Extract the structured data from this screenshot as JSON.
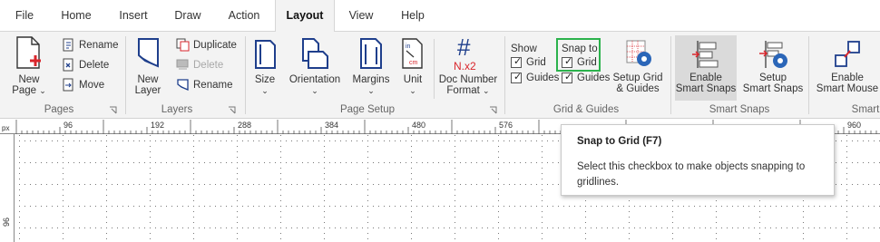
{
  "tabs": [
    {
      "label": "File",
      "active": false
    },
    {
      "label": "Home",
      "active": false
    },
    {
      "label": "Insert",
      "active": false
    },
    {
      "label": "Draw",
      "active": false
    },
    {
      "label": "Action",
      "active": false
    },
    {
      "label": "Layout",
      "active": true
    },
    {
      "label": "View",
      "active": false
    },
    {
      "label": "Help",
      "active": false
    }
  ],
  "pages_group": {
    "label": "Pages",
    "new_page": {
      "line1": "New",
      "line2": "Page",
      "icon": "new-page-icon"
    },
    "rename": "Rename",
    "delete": "Delete",
    "move": "Move"
  },
  "layers_group": {
    "label": "Layers",
    "new_layer": {
      "line1": "New",
      "line2": "Layer",
      "icon": "new-layer-icon"
    },
    "duplicate": "Duplicate",
    "delete": "Delete",
    "rename": "Rename"
  },
  "page_setup_group": {
    "label": "Page Setup",
    "size": "Size",
    "orientation": "Orientation",
    "margins": "Margins",
    "unit": "Unit",
    "doc_number": {
      "line1": "Doc Number",
      "line2": "Format",
      "icon_text": "N.x2"
    }
  },
  "grid_group": {
    "label": "Grid & Guides",
    "show_label": "Show",
    "show_grid": {
      "label": "Grid",
      "checked": true
    },
    "show_guides": {
      "label": "Guides",
      "checked": true
    },
    "snap_label": "Snap to",
    "snap_grid": {
      "label": "Grid",
      "checked": true
    },
    "snap_guides": {
      "label": "Guides",
      "checked": true
    },
    "setup": {
      "line1": "Setup Grid",
      "line2": "& Guides"
    }
  },
  "smart_snaps_group": {
    "label": "Smart Snaps",
    "enable": {
      "line1": "Enable",
      "line2": "Smart Snaps",
      "pressed": true
    },
    "setup": {
      "line1": "Setup",
      "line2": "Smart Snaps"
    }
  },
  "smart_group": {
    "label": "Smart",
    "enable_mouse": {
      "line1": "Enable",
      "line2": "Smart Mouse"
    }
  },
  "ruler": {
    "unit_label": "px",
    "top_labels": [
      "96",
      "192",
      "288",
      "384",
      "480",
      "576",
      "960"
    ],
    "left_labels": [
      "96"
    ]
  },
  "tooltip": {
    "title": "Snap to Grid (F7)",
    "body": "Select this checkbox to make objects snapping to gridlines."
  },
  "colors": {
    "ribbon_bg": "#f3f3f3",
    "highlight": "#2bb24c",
    "icon_blue": "#1f3f8c",
    "icon_red": "#d9262c"
  }
}
